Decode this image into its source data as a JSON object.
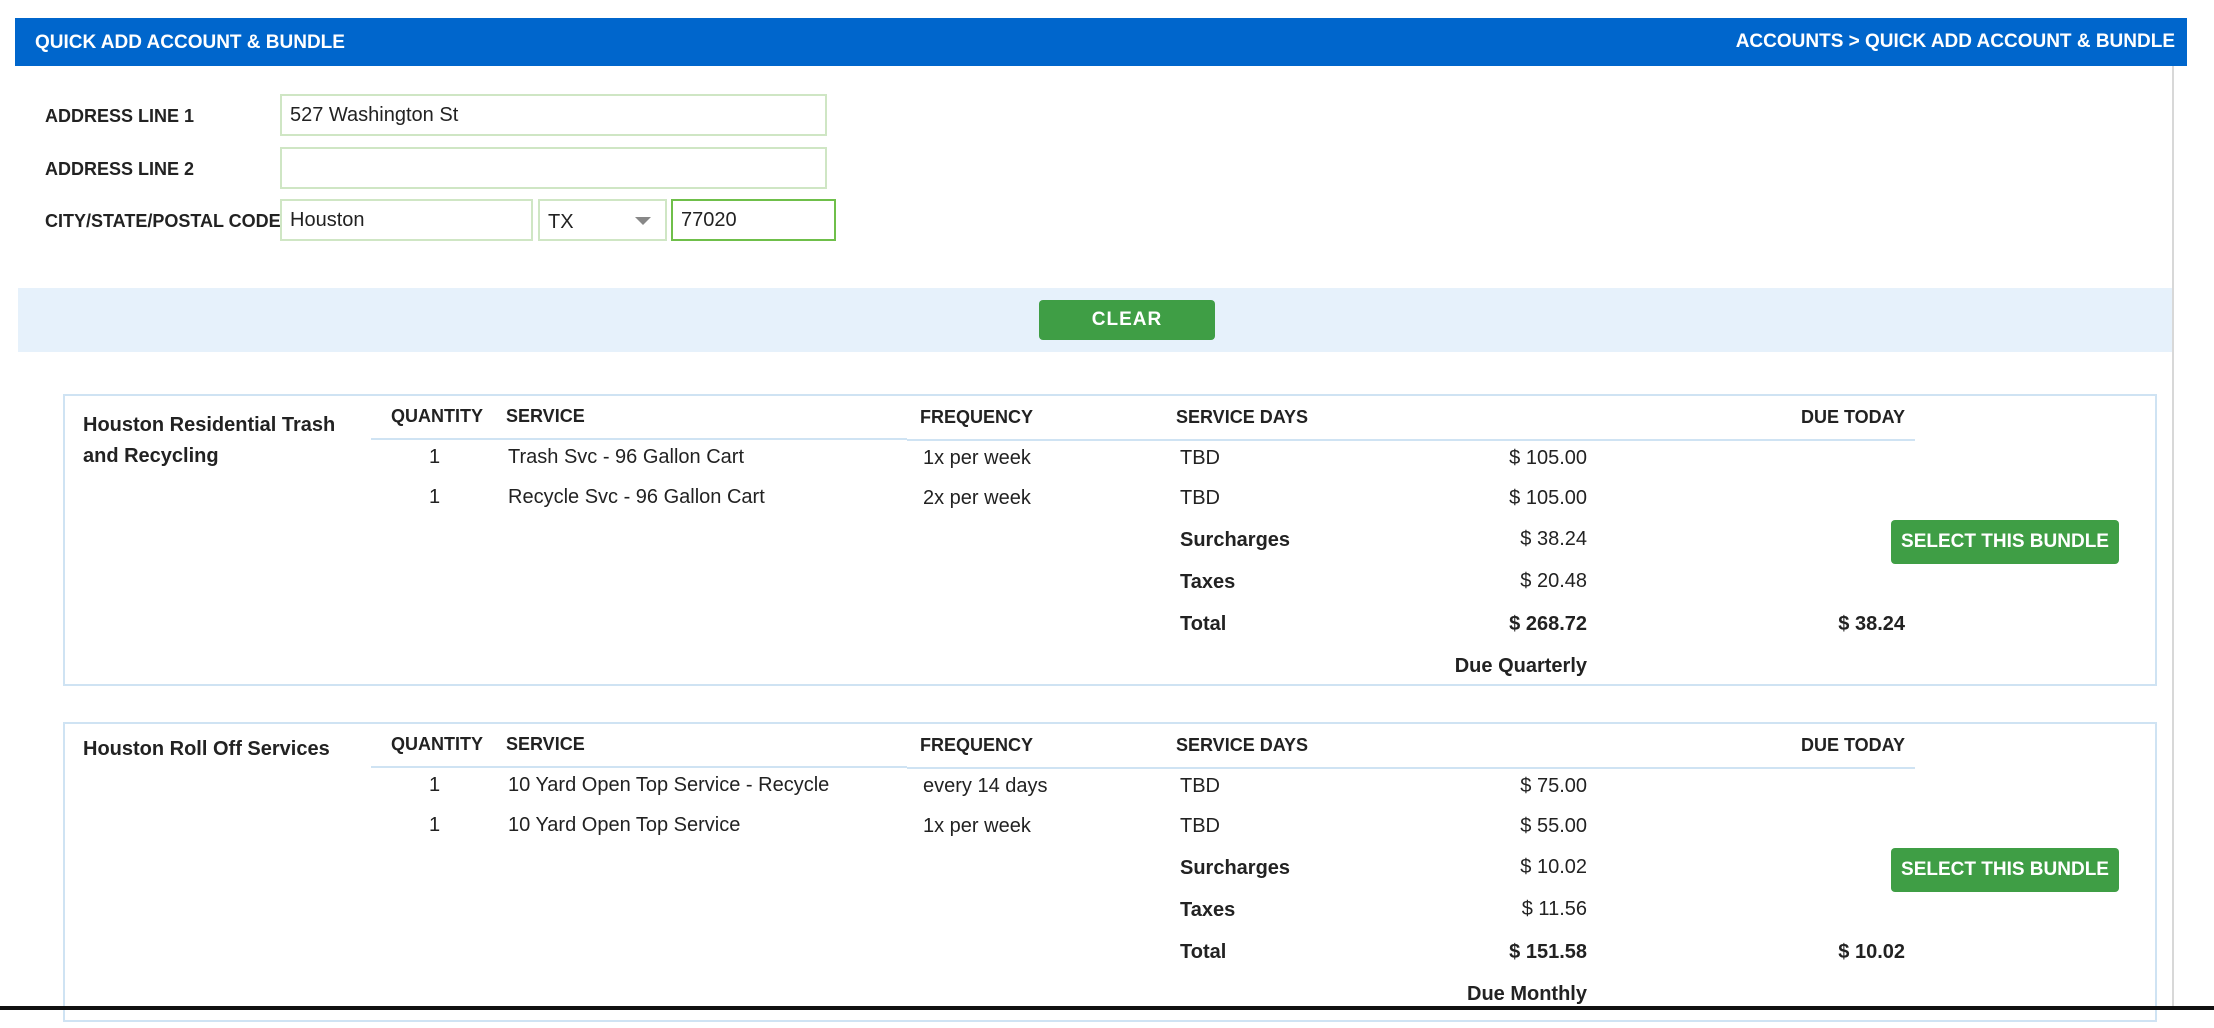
{
  "header": {
    "title": "QUICK ADD ACCOUNT & BUNDLE",
    "breadcrumb": "ACCOUNTS > QUICK ADD ACCOUNT & BUNDLE"
  },
  "form": {
    "address1_label": "ADDRESS LINE 1",
    "address1_value": "527 Washington St",
    "address2_label": "ADDRESS LINE 2",
    "address2_value": "",
    "city_state_label": "CITY/STATE/POSTAL CODE",
    "city_value": "Houston",
    "state_value": "TX",
    "postal_value": "77020"
  },
  "clear_label": "CLEAR",
  "columns": {
    "quantity": "QUANTITY",
    "service": "SERVICE",
    "frequency": "FREQUENCY",
    "service_days": "SERVICE DAYS",
    "due_today": "DUE TODAY"
  },
  "bundles": [
    {
      "name": "Houston Residential Trash and Recycling",
      "rows": [
        {
          "qty": "1",
          "service": "Trash Svc - 96 Gallon Cart",
          "frequency": "1x per week",
          "days": "TBD",
          "price": "$ 105.00"
        },
        {
          "qty": "1",
          "service": "Recycle Svc - 96 Gallon Cart",
          "frequency": "2x per week",
          "days": "TBD",
          "price": "$ 105.00"
        }
      ],
      "surcharges_label": "Surcharges",
      "surcharges": "$ 38.24",
      "taxes_label": "Taxes",
      "taxes": "$ 20.48",
      "total_label": "Total",
      "total": "$ 268.72",
      "due_today": "$ 38.24",
      "due_period": "Due Quarterly",
      "button": "SELECT THIS BUNDLE"
    },
    {
      "name": "Houston Roll Off Services",
      "rows": [
        {
          "qty": "1",
          "service": "10 Yard Open Top Service - Recycle",
          "frequency": "every 14 days",
          "days": "TBD",
          "price": "$ 75.00"
        },
        {
          "qty": "1",
          "service": "10 Yard Open Top Service",
          "frequency": "1x per week",
          "days": "TBD",
          "price": "$ 55.00"
        }
      ],
      "surcharges_label": "Surcharges",
      "surcharges": "$ 10.02",
      "taxes_label": "Taxes",
      "taxes": "$ 11.56",
      "total_label": "Total",
      "total": "$ 151.58",
      "due_today": "$ 10.02",
      "due_period": "Due Monthly",
      "button": "SELECT THIS BUNDLE"
    }
  ]
}
